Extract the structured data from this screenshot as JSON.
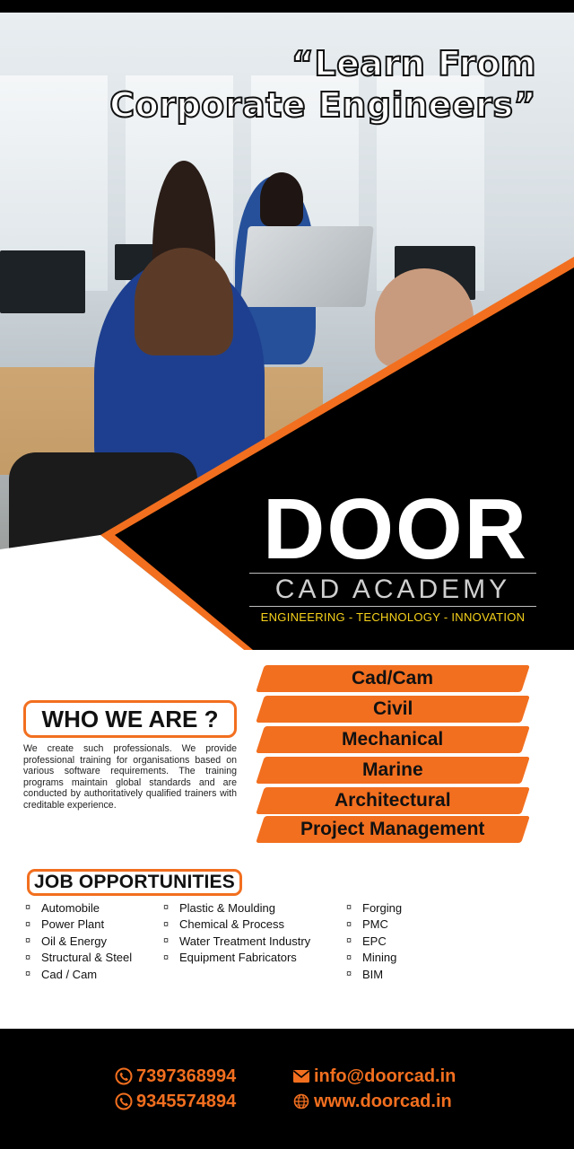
{
  "headline": {
    "line1": "“Learn From",
    "line2": "Corporate Engineers”"
  },
  "logo": {
    "name": "DOOR",
    "subtitle": "CAD ACADEMY",
    "tagline": "ENGINEERING - TECHNOLOGY - INNOVATION"
  },
  "courses": [
    "Cad/Cam",
    "Civil",
    "Mechanical",
    "Marine",
    "Architectural",
    "Project Management"
  ],
  "who_we_are": {
    "title": "WHO WE ARE ?",
    "text": "We create such professionals. We provide professional training for organisations based on various software requirements. The training programs maintain global standards and are conducted by authoritatively qualified trainers with creditable experience."
  },
  "jobs": {
    "title": "JOB OPPORTUNITIES",
    "bullet": "¤",
    "col1": [
      "Automobile",
      "Power Plant",
      "Oil & Energy",
      "Structural & Steel",
      "Cad / Cam"
    ],
    "col2": [
      "Plastic & Moulding",
      "Chemical & Process",
      "Water Treatment Industry",
      "Equipment Fabricators"
    ],
    "col3": [
      "Forging",
      "PMC",
      "EPC",
      "Mining",
      "BIM"
    ]
  },
  "contact": {
    "phone1": "7397368994",
    "phone2": "9345574894",
    "email": "info@doorcad.in",
    "website": "www.doorcad.in"
  },
  "colors": {
    "accent": "#f26f1f",
    "black": "#000000",
    "tagline": "#f7d21b"
  },
  "icons": [
    "phone-icon",
    "mail-icon",
    "globe-icon"
  ]
}
